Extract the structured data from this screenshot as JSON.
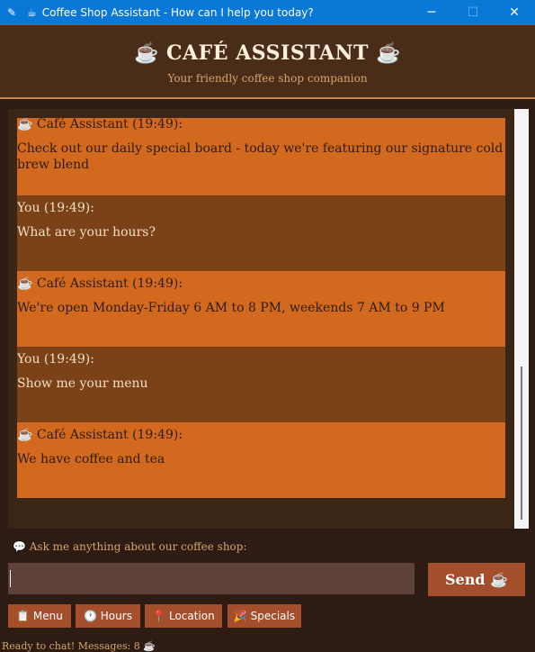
{
  "window": {
    "title": "Coffee Shop Assistant - How can I help you today?",
    "minimize_glyph": "─",
    "maximize_glyph": "☐",
    "close_glyph": "✕"
  },
  "header": {
    "title": "☕ CAFÉ ASSISTANT ☕",
    "subtitle": "Your friendly coffee shop companion"
  },
  "messages": [
    {
      "role": "bot",
      "speaker": "☕ Café Assistant (19:49):",
      "text": "Check out our daily special board - today we're featuring our signature cold brew blend"
    },
    {
      "role": "user",
      "speaker": "You (19:49):",
      "text": "What are your hours?"
    },
    {
      "role": "bot",
      "speaker": "☕ Café Assistant (19:49):",
      "text": "We're open Monday-Friday 6 AM to 8 PM, weekends 7 AM to 9 PM"
    },
    {
      "role": "user",
      "speaker": "You (19:49):",
      "text": "Show me your menu"
    },
    {
      "role": "bot",
      "speaker": "☕ Café Assistant (19:49):",
      "text": "We have coffee and tea"
    }
  ],
  "input": {
    "prompt": "💬 Ask me anything about our coffee shop:",
    "value": "",
    "send_label": "Send ☕"
  },
  "quick_buttons": [
    {
      "label": "📋 Menu"
    },
    {
      "label": "🕐 Hours"
    },
    {
      "label": "📍 Location"
    },
    {
      "label": "🎉 Specials"
    }
  ],
  "status": "Ready to chat! Messages: 8 ☕",
  "colors": {
    "titlebar": "#0a78d7",
    "header_bg": "#4a2d19",
    "bot_bubble": "#d2691e",
    "user_bubble": "#7a4216",
    "button": "#a54e2c"
  }
}
